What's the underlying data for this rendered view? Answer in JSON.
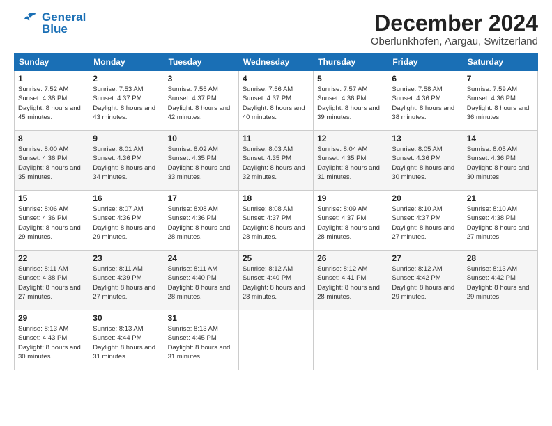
{
  "logo": {
    "line1": "General",
    "line2": "Blue"
  },
  "title": "December 2024",
  "subtitle": "Oberlunkhofen, Aargau, Switzerland",
  "days_of_week": [
    "Sunday",
    "Monday",
    "Tuesday",
    "Wednesday",
    "Thursday",
    "Friday",
    "Saturday"
  ],
  "weeks": [
    [
      {
        "day": "1",
        "sunrise": "7:52 AM",
        "sunset": "4:38 PM",
        "daylight": "8 hours and 45 minutes."
      },
      {
        "day": "2",
        "sunrise": "7:53 AM",
        "sunset": "4:37 PM",
        "daylight": "8 hours and 43 minutes."
      },
      {
        "day": "3",
        "sunrise": "7:55 AM",
        "sunset": "4:37 PM",
        "daylight": "8 hours and 42 minutes."
      },
      {
        "day": "4",
        "sunrise": "7:56 AM",
        "sunset": "4:37 PM",
        "daylight": "8 hours and 40 minutes."
      },
      {
        "day": "5",
        "sunrise": "7:57 AM",
        "sunset": "4:36 PM",
        "daylight": "8 hours and 39 minutes."
      },
      {
        "day": "6",
        "sunrise": "7:58 AM",
        "sunset": "4:36 PM",
        "daylight": "8 hours and 38 minutes."
      },
      {
        "day": "7",
        "sunrise": "7:59 AM",
        "sunset": "4:36 PM",
        "daylight": "8 hours and 36 minutes."
      }
    ],
    [
      {
        "day": "8",
        "sunrise": "8:00 AM",
        "sunset": "4:36 PM",
        "daylight": "8 hours and 35 minutes."
      },
      {
        "day": "9",
        "sunrise": "8:01 AM",
        "sunset": "4:36 PM",
        "daylight": "8 hours and 34 minutes."
      },
      {
        "day": "10",
        "sunrise": "8:02 AM",
        "sunset": "4:35 PM",
        "daylight": "8 hours and 33 minutes."
      },
      {
        "day": "11",
        "sunrise": "8:03 AM",
        "sunset": "4:35 PM",
        "daylight": "8 hours and 32 minutes."
      },
      {
        "day": "12",
        "sunrise": "8:04 AM",
        "sunset": "4:35 PM",
        "daylight": "8 hours and 31 minutes."
      },
      {
        "day": "13",
        "sunrise": "8:05 AM",
        "sunset": "4:36 PM",
        "daylight": "8 hours and 30 minutes."
      },
      {
        "day": "14",
        "sunrise": "8:05 AM",
        "sunset": "4:36 PM",
        "daylight": "8 hours and 30 minutes."
      }
    ],
    [
      {
        "day": "15",
        "sunrise": "8:06 AM",
        "sunset": "4:36 PM",
        "daylight": "8 hours and 29 minutes."
      },
      {
        "day": "16",
        "sunrise": "8:07 AM",
        "sunset": "4:36 PM",
        "daylight": "8 hours and 29 minutes."
      },
      {
        "day": "17",
        "sunrise": "8:08 AM",
        "sunset": "4:36 PM",
        "daylight": "8 hours and 28 minutes."
      },
      {
        "day": "18",
        "sunrise": "8:08 AM",
        "sunset": "4:37 PM",
        "daylight": "8 hours and 28 minutes."
      },
      {
        "day": "19",
        "sunrise": "8:09 AM",
        "sunset": "4:37 PM",
        "daylight": "8 hours and 28 minutes."
      },
      {
        "day": "20",
        "sunrise": "8:10 AM",
        "sunset": "4:37 PM",
        "daylight": "8 hours and 27 minutes."
      },
      {
        "day": "21",
        "sunrise": "8:10 AM",
        "sunset": "4:38 PM",
        "daylight": "8 hours and 27 minutes."
      }
    ],
    [
      {
        "day": "22",
        "sunrise": "8:11 AM",
        "sunset": "4:38 PM",
        "daylight": "8 hours and 27 minutes."
      },
      {
        "day": "23",
        "sunrise": "8:11 AM",
        "sunset": "4:39 PM",
        "daylight": "8 hours and 27 minutes."
      },
      {
        "day": "24",
        "sunrise": "8:11 AM",
        "sunset": "4:40 PM",
        "daylight": "8 hours and 28 minutes."
      },
      {
        "day": "25",
        "sunrise": "8:12 AM",
        "sunset": "4:40 PM",
        "daylight": "8 hours and 28 minutes."
      },
      {
        "day": "26",
        "sunrise": "8:12 AM",
        "sunset": "4:41 PM",
        "daylight": "8 hours and 28 minutes."
      },
      {
        "day": "27",
        "sunrise": "8:12 AM",
        "sunset": "4:42 PM",
        "daylight": "8 hours and 29 minutes."
      },
      {
        "day": "28",
        "sunrise": "8:13 AM",
        "sunset": "4:42 PM",
        "daylight": "8 hours and 29 minutes."
      }
    ],
    [
      {
        "day": "29",
        "sunrise": "8:13 AM",
        "sunset": "4:43 PM",
        "daylight": "8 hours and 30 minutes."
      },
      {
        "day": "30",
        "sunrise": "8:13 AM",
        "sunset": "4:44 PM",
        "daylight": "8 hours and 31 minutes."
      },
      {
        "day": "31",
        "sunrise": "8:13 AM",
        "sunset": "4:45 PM",
        "daylight": "8 hours and 31 minutes."
      },
      null,
      null,
      null,
      null
    ]
  ],
  "labels": {
    "sunrise": "Sunrise:",
    "sunset": "Sunset:",
    "daylight": "Daylight:"
  }
}
